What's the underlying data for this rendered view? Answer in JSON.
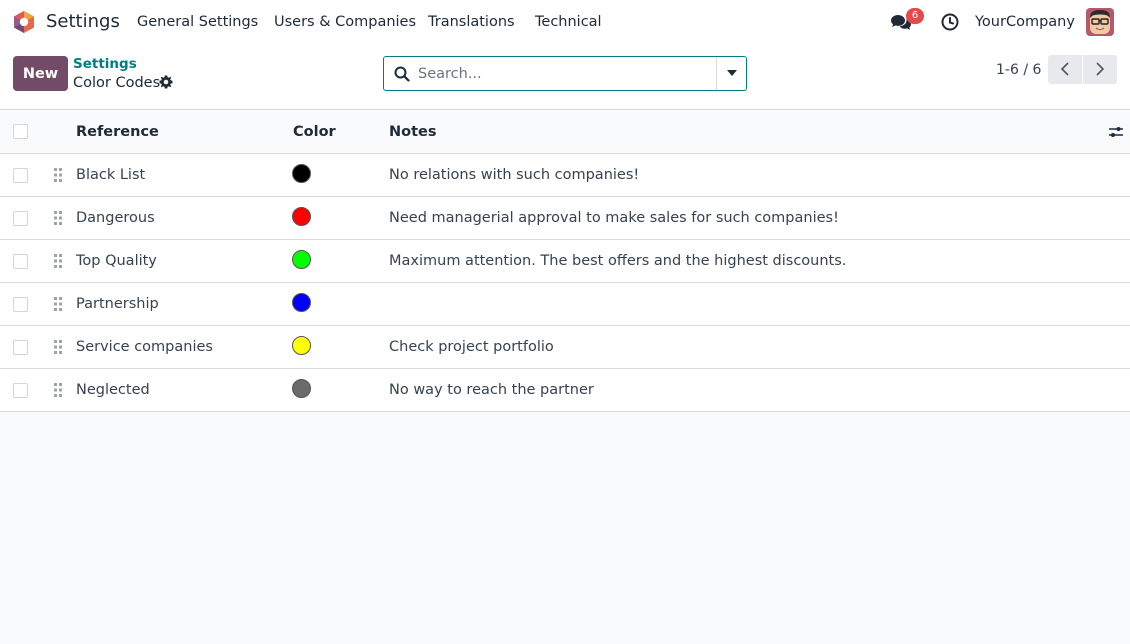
{
  "navbar": {
    "app_name": "Settings",
    "menu": [
      {
        "label": "General Settings"
      },
      {
        "label": "Users & Companies"
      },
      {
        "label": "Translations"
      },
      {
        "label": "Technical"
      }
    ],
    "messages_badge": "6",
    "company": "YourCompany"
  },
  "control_panel": {
    "new_label": "New",
    "breadcrumb_parent": "Settings",
    "title": "Color Codes",
    "search_placeholder": "Search...",
    "pager": "1-6 / 6"
  },
  "table": {
    "columns": [
      "Reference",
      "Color",
      "Notes"
    ],
    "rows": [
      {
        "reference": "Black List",
        "color": "#000000",
        "notes": "No relations with such companies!"
      },
      {
        "reference": "Dangerous",
        "color": "#ff0000",
        "notes": "Need managerial approval to make sales for such companies!"
      },
      {
        "reference": "Top Quality",
        "color": "#00ff00",
        "notes": "Maximum attention. The best offers and the highest discounts."
      },
      {
        "reference": "Partnership",
        "color": "#0000ff",
        "notes": ""
      },
      {
        "reference": "Service companies",
        "color": "#ffff00",
        "notes": "Check project portfolio"
      },
      {
        "reference": "Neglected",
        "color": "#6b6b6b",
        "notes": "No way to reach the partner"
      }
    ]
  },
  "colors": {
    "brand": "#714b67",
    "accent": "#017e84",
    "badge": "#e34a4a"
  }
}
